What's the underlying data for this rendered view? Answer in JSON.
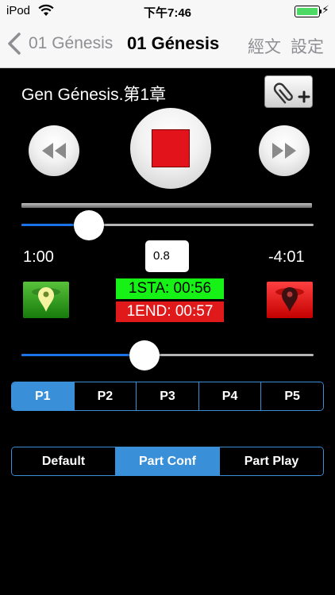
{
  "status_bar": {
    "carrier": "iPod",
    "time": "下午7:46"
  },
  "nav": {
    "back_label": "01 Génesis",
    "title": "01 Génesis",
    "text_button": "經文",
    "settings_button": "設定"
  },
  "player": {
    "chapter_title": "Gen Génesis.第1章",
    "elapsed": "1:00",
    "remaining": "-4:01",
    "speed": "0.8",
    "progress": 0.23,
    "second_slider": 0.42,
    "sta_label": "1STA: 00:56",
    "end_label": "1END: 00:57"
  },
  "parts": {
    "items": [
      {
        "label": "P1"
      },
      {
        "label": "P2"
      },
      {
        "label": "P3"
      },
      {
        "label": "P4"
      },
      {
        "label": "P5"
      }
    ],
    "selected": "P1"
  },
  "modes": {
    "items": [
      {
        "label": "Default"
      },
      {
        "label": "Part Conf"
      },
      {
        "label": "Part Play"
      }
    ],
    "selected": "Part Conf"
  },
  "colors": {
    "accent": "#3a8fd9",
    "start_marker": "#2fa020",
    "end_marker": "#e01a1a",
    "sta_bg": "#16f216",
    "end_bg": "#e01a1a",
    "stop": "#e3131b"
  }
}
